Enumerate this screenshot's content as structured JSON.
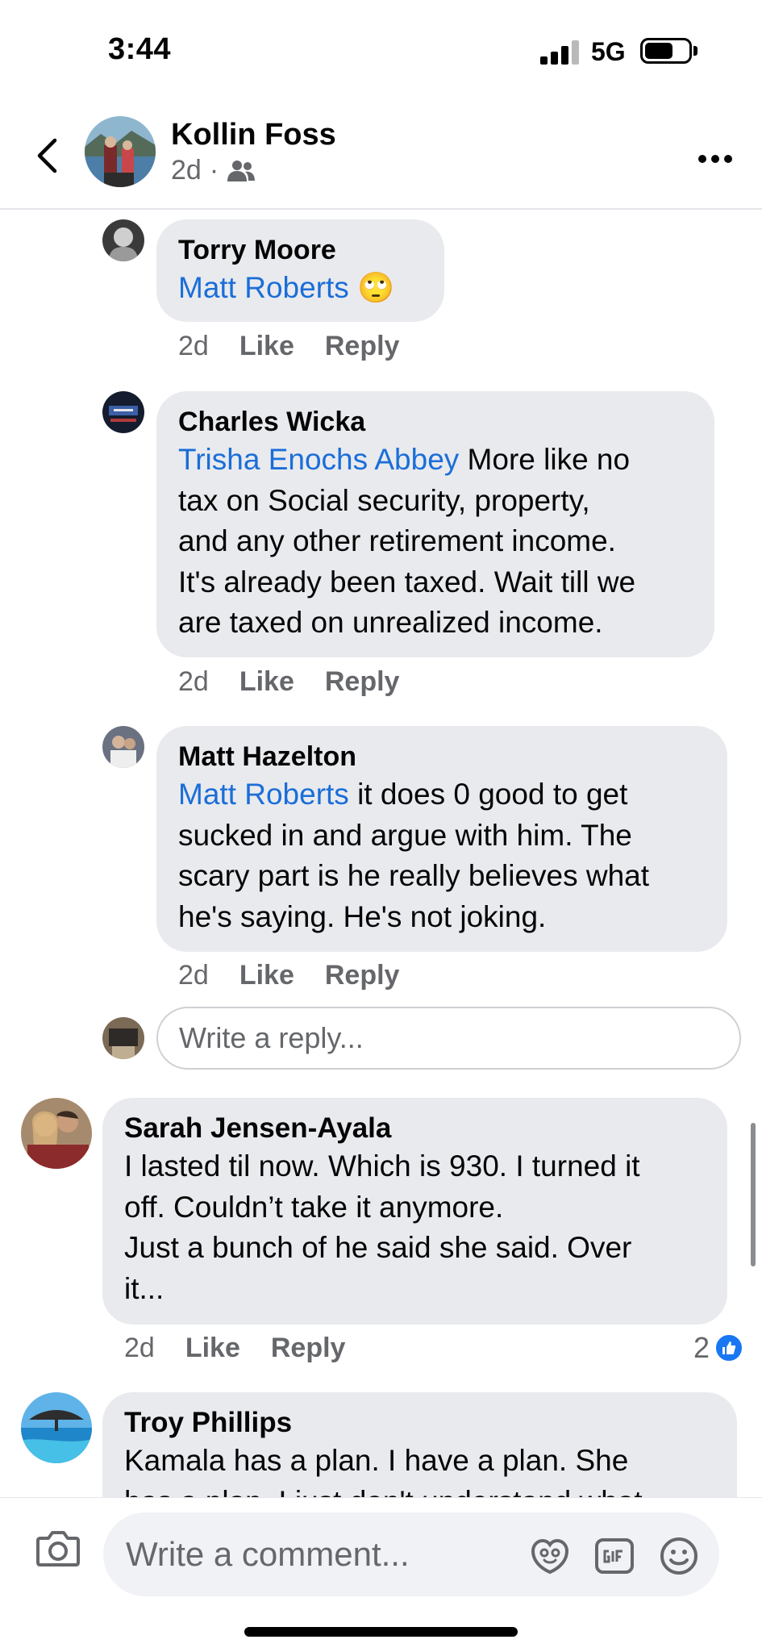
{
  "status_bar": {
    "time": "3:44",
    "network": "5G"
  },
  "header": {
    "name": "Kollin Foss",
    "age": "2d",
    "separator": "·",
    "audience_icon": "friends-icon"
  },
  "comments": [
    {
      "author": "Torry Moore",
      "mention": "Matt Roberts",
      "emoji": "🙄",
      "lines": [],
      "time": "2d",
      "like": "Like",
      "reply": "Reply"
    },
    {
      "author": "Charles Wicka",
      "mention": "Trisha Enochs Abbey",
      "first_line_rest": " More like no",
      "lines": [
        "tax on Social security,  property,",
        "and any other retirement income.",
        "It's already been taxed. Wait till we",
        "are taxed on unrealized income."
      ],
      "time": "2d",
      "like": "Like",
      "reply": "Reply"
    },
    {
      "author": "Matt Hazelton",
      "mention": "Matt Roberts",
      "first_line_rest": " it does 0 good to get",
      "lines": [
        "sucked in and argue with him. The",
        "scary part is he really believes what",
        "he's saying. He's not joking."
      ],
      "time": "2d",
      "like": "Like",
      "reply": "Reply"
    },
    {
      "author": "Sarah Jensen-Ayala",
      "lines": [
        "I lasted til now. Which is 930. I turned it",
        "off. Couldn’t take it anymore.",
        "Just a bunch of he said she said. Over",
        "it..."
      ],
      "time": "2d",
      "like": "Like",
      "reply": "Reply",
      "reaction_count": "2"
    },
    {
      "author": "Troy Phillips",
      "lines": [
        "Kamala has a plan. I have a plan. She",
        "has a plan. I just don't understand what"
      ]
    }
  ],
  "reply_box": {
    "placeholder": "Write a reply..."
  },
  "composer": {
    "placeholder": "Write a comment...",
    "icons": [
      "camera-icon",
      "avatar-sticker-icon",
      "gif-icon",
      "emoji-icon"
    ]
  },
  "colors": {
    "mention": "#1a6ed8",
    "bubble": "#e9eaee",
    "like_blue": "#1877f2"
  }
}
